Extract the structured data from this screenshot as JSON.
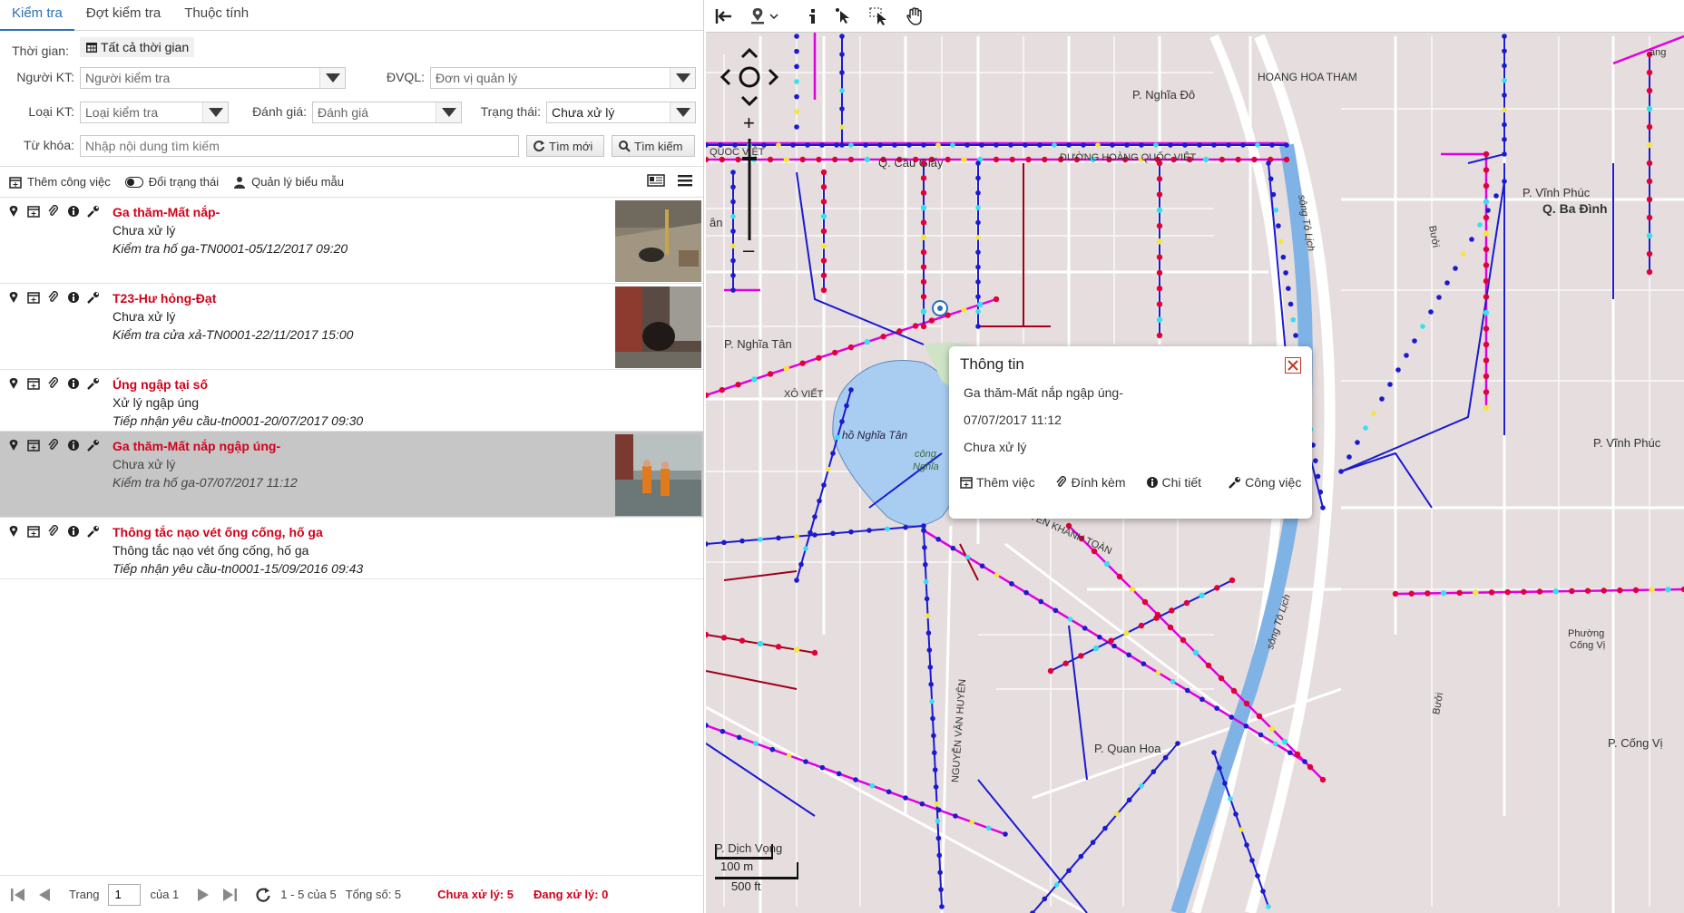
{
  "tabs": [
    {
      "label": "Kiểm tra",
      "active": true
    },
    {
      "label": "Đợt kiểm tra",
      "active": false
    },
    {
      "label": "Thuộc tính",
      "active": false
    }
  ],
  "filters": {
    "time_label": "Thời gian:",
    "time_value": "Tất cả thời gian",
    "inspector_label": "Người KT:",
    "inspector_placeholder": "Người kiểm tra",
    "unit_label": "ĐVQL:",
    "unit_placeholder": "Đơn vị quản lý",
    "type_label": "Loại KT:",
    "type_placeholder": "Loại kiểm tra",
    "rating_label": "Đánh giá:",
    "rating_placeholder": "Đánh giá",
    "state_label": "Trạng thái:",
    "state_value": "Chưa xử lý",
    "keyword_label": "Từ khóa:",
    "keyword_placeholder": "Nhập nội dung tìm kiếm",
    "new_search_label": "Tìm mới",
    "search_label": "Tìm kiếm"
  },
  "toolbar": {
    "add_job": "Thêm công việc",
    "change_state": "Đổi trạng thái",
    "manage_forms": "Quản lý biểu mẫu"
  },
  "items": [
    {
      "title": "Ga thăm-Mất nắp-",
      "status": "Chưa xử lý",
      "sub": "Kiểm tra hố ga-TN0001-05/12/2017 09:20",
      "thumb": true,
      "selected": false
    },
    {
      "title": "T23-Hư hỏng-Đạt",
      "status": "Chưa xử lý",
      "sub": "Kiểm tra cửa xả-TN0001-22/11/2017 15:00",
      "thumb": true,
      "selected": false
    },
    {
      "title": "Úng ngập tại số",
      "status": "Xử lý ngập úng",
      "sub": "Tiếp nhận yêu cầu-tn0001-20/07/2017 09:30",
      "thumb": false,
      "selected": false
    },
    {
      "title": "Ga thăm-Mất nắp ngập úng-",
      "status": "Chưa xử lý",
      "sub": "Kiểm tra hố ga-07/07/2017 11:12",
      "thumb": true,
      "selected": true
    },
    {
      "title": "Thông tắc nạo vét ống cống, hố ga",
      "status": "Thông tắc nạo vét ống cống, hố ga",
      "sub": "Tiếp nhận yêu cầu-tn0001-15/09/2016 09:43",
      "thumb": false,
      "selected": false
    }
  ],
  "pager": {
    "page_label": "Trang",
    "page_value": "1",
    "of_label": "của 1",
    "range": "1 - 5 của 5",
    "total": "Tổng số:  5",
    "pending": "Chưa xử lý:  5",
    "processing": "Đang xử lý:  0"
  },
  "popup": {
    "title": "Thông tin",
    "line1": "Ga thăm-Mất nắp ngập úng-",
    "line2": "07/07/2017 11:12",
    "line3": "Chưa xử lý",
    "add_job": "Thêm việc",
    "attach": "Đính kèm",
    "detail": "Chi tiết",
    "work": "Công việc"
  },
  "map": {
    "labels": {
      "hoang_hoa_tham": "HOANG HOA THAM",
      "p_nghia_do": "P. Nghĩa Đô",
      "q_cau_giay": "Q. Cầu Giấy",
      "duong_hqv": "ĐƯỜNG HOÀNG QUỐC VIỆT",
      "quoc_viet": "QUOC VIỆT",
      "p_vinh_phuc": "P. Vĩnh Phúc",
      "q_ba_dinh": "Q. Ba Đình",
      "p_nghia_tan": "P. Nghĩa Tân",
      "xo_viet": "XÔ VIẾT",
      "ho_nghia_tan": "hồ Nghĩa Tân",
      "cong_vien": "công",
      "nghia": "Nghĩa",
      "nguyen_khanh_toan": "NGUYỄN KHÁNH TOÀN",
      "p_vinh_phuc_2": "P. Vĩnh Phúc",
      "song_to_lich": "sông Tô Lịch",
      "song_to_lich_2": "sông Tô Lịch",
      "phuong_cong_vi": "Phường",
      "phuong_cong_vi_2": "Cống Vị",
      "nguyen_van_huyen": "NGUYỄN VĂN HUYÊN",
      "p_quan_hoa": "P. Quan Hoa",
      "p_dich_vong": "P. Dịch Vọng",
      "p_cong_vi": "P. Cống Vị",
      "buoi": "Bưởi",
      "buoi_2": "Bưởi",
      "an": "ân",
      "ang": "ang"
    },
    "scale_m": "100 m",
    "scale_ft": "500 ft"
  },
  "colors": {
    "accent": "#2a70b8",
    "red_text": "#d0021b",
    "map_bg": "#e4dcdc",
    "pipe_blue": "#1a1ad0",
    "pipe_magenta": "#e000e0",
    "river": "#7fb2e5"
  }
}
